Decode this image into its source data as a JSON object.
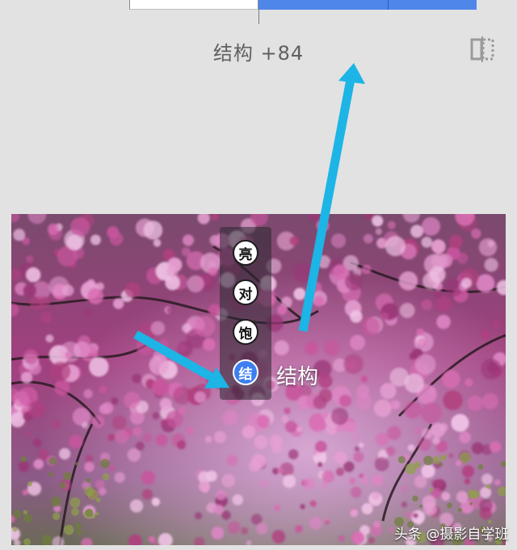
{
  "header": {
    "adjustment_label": "结构 +84",
    "compare_icon": "split-compare-icon"
  },
  "progress": {
    "value": 84
  },
  "tool_menu": {
    "items": [
      {
        "label": "亮",
        "active": false
      },
      {
        "label": "对",
        "active": false
      },
      {
        "label": "饱",
        "active": false
      },
      {
        "label": "结",
        "active": true
      }
    ],
    "active_label": "结构"
  },
  "annotations": {
    "arrow_color": "#1db4e6"
  },
  "watermark": "头条 @摄影自学班",
  "colors": {
    "accent_blue": "#4f86ea",
    "active_tool": "#3d7ff0",
    "background": "#e2e2e2"
  }
}
